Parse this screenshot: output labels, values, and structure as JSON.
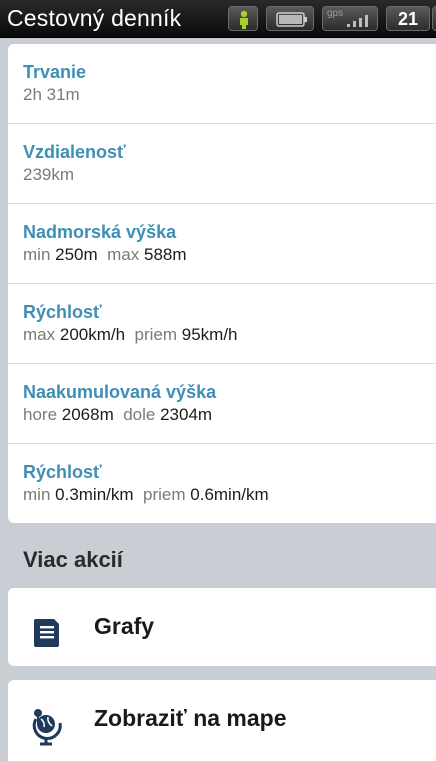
{
  "statusbar": {
    "title": "Cestovný denník",
    "gps_label": "gps",
    "time": "21",
    "icons": [
      "gps-person-icon",
      "battery-icon",
      "signal-icon"
    ]
  },
  "stats": [
    {
      "label": "Trvanie",
      "value_plain": "2h 31m"
    },
    {
      "label": "Vzdialenosť",
      "value_plain": "239km"
    },
    {
      "label": "Nadmorská výška",
      "p1": "min",
      "v1": "250m",
      "p2": "max",
      "v2": "588m"
    },
    {
      "label": "Rýchlosť",
      "p1": "max",
      "v1": "200km/h",
      "p2": "priem",
      "v2": "95km/h"
    },
    {
      "label": "Naakumulovaná výška",
      "p1": "hore",
      "v1": "2068m",
      "p2": "dole",
      "v2": "2304m"
    },
    {
      "label": "Rýchlosť",
      "p1": "min",
      "v1": "0.3min/km",
      "p2": "priem",
      "v2": "0.6min/km"
    }
  ],
  "more_actions": {
    "heading": "Viac akcií",
    "items": [
      {
        "label": "Grafy",
        "icon": "document-icon"
      },
      {
        "label": "Zobraziť na mape",
        "icon": "globe-pin-icon"
      }
    ]
  },
  "colors": {
    "label_blue": "#3e8fb5",
    "icon_navy": "#1f3a5c",
    "background": "#c8ced4"
  }
}
